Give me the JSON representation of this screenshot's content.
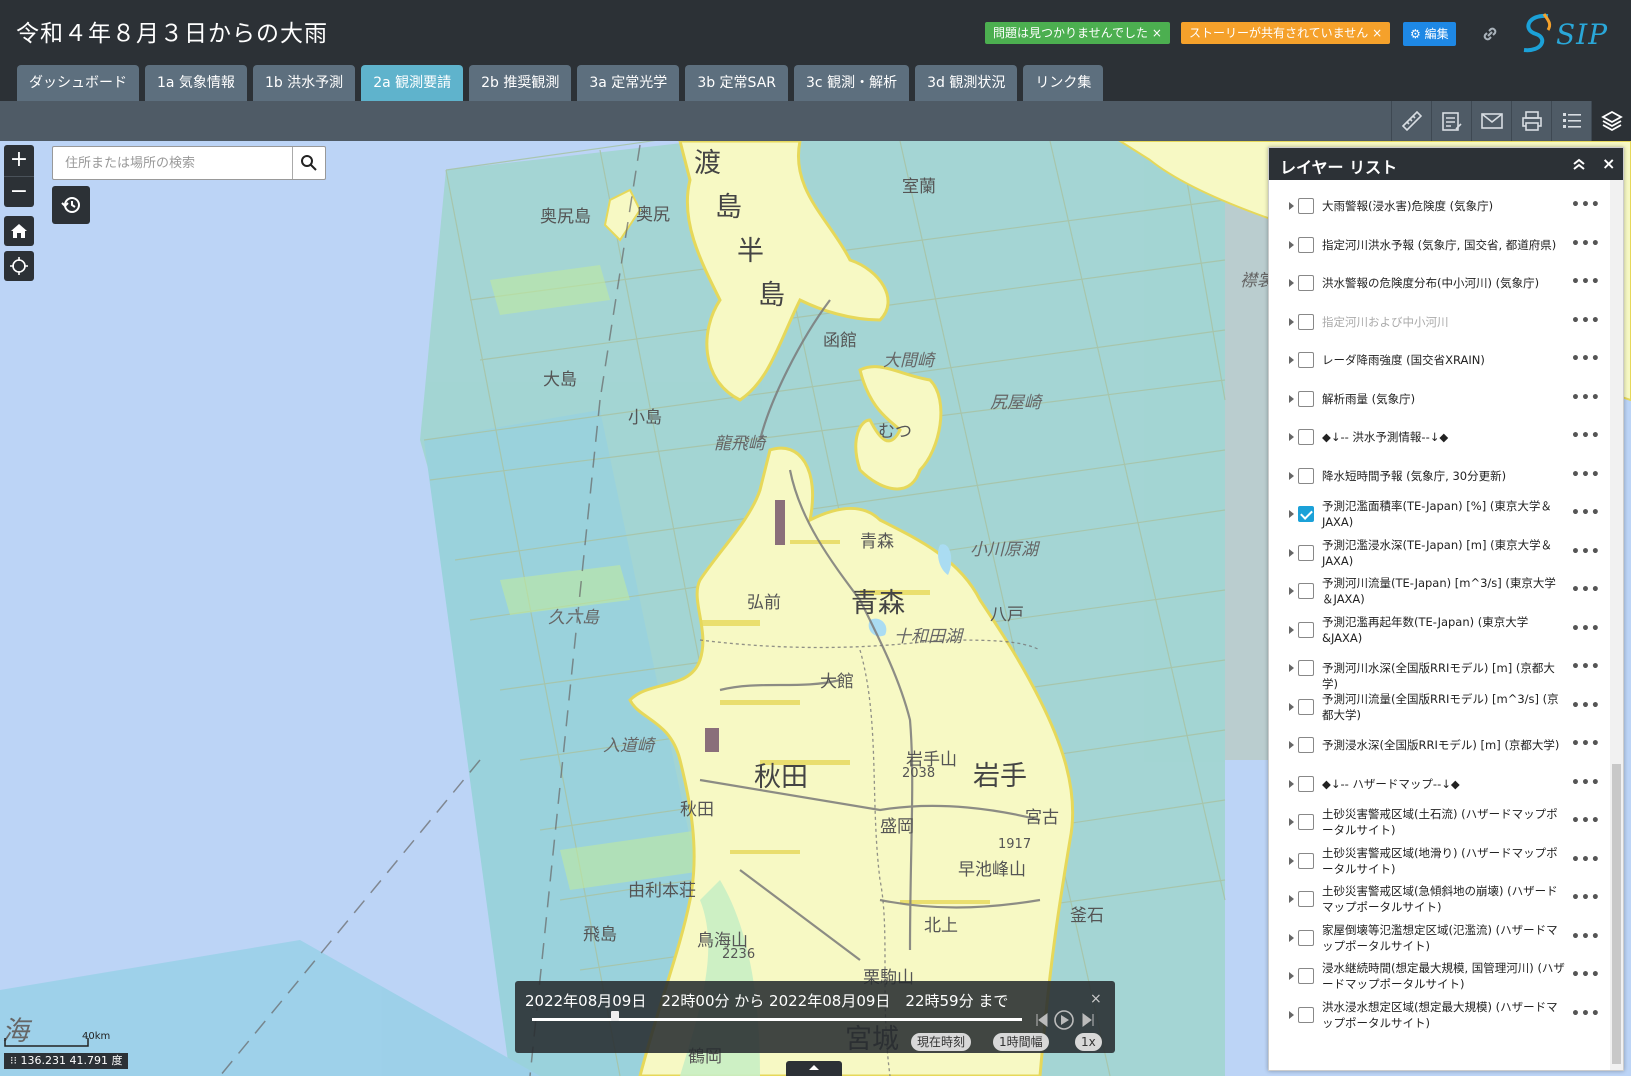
{
  "header": {
    "title": "令和４年８月３日からの大雨",
    "badge_problems": "問題は見つかりませんでした ×",
    "badge_story": "ストーリーが共有されていません ×",
    "edit_label": "編集",
    "logo_text": "SIP"
  },
  "tabs": [
    {
      "label": "ダッシュボード"
    },
    {
      "label": "1a 気象情報"
    },
    {
      "label": "1b 洪水予測"
    },
    {
      "label": "2a 観測要請"
    },
    {
      "label": "2b 推奨観測"
    },
    {
      "label": "3a 定常光学"
    },
    {
      "label": "3b 定常SAR"
    },
    {
      "label": "3c 観測・解析"
    },
    {
      "label": "3d 観測状況"
    },
    {
      "label": "リンク集"
    }
  ],
  "active_tab": "2a 観測要請",
  "search": {
    "placeholder": "住所または場所の検索"
  },
  "zoom": {
    "in_label": "+",
    "out_label": "−"
  },
  "layer_panel": {
    "title": "レイヤー リスト",
    "close_label": "×",
    "items": [
      {
        "label": "大雨警報(浸水害)危険度 (気象庁)",
        "checked": false
      },
      {
        "label": "指定河川洪水予報 (気象庁, 国交省, 都道府県)",
        "checked": false
      },
      {
        "label": "洪水警報の危険度分布(中小河川) (気象庁)",
        "checked": false
      },
      {
        "label": "指定河川および中小河川",
        "checked": false,
        "dim": true
      },
      {
        "label": "レーダ降雨強度 (国交省XRAIN)",
        "checked": false
      },
      {
        "label": "解析雨量 (気象庁)",
        "checked": false
      },
      {
        "label": "◆↓-- 洪水予測情報--↓◆",
        "checked": false
      },
      {
        "label": "降水短時間予報 (気象庁, 30分更新)",
        "checked": false
      },
      {
        "label": "予測氾濫面積率(TE-Japan) [%] (東京大学＆JAXA)",
        "checked": true
      },
      {
        "label": "予測氾濫浸水深(TE-Japan) [m] (東京大学＆JAXA)",
        "checked": false
      },
      {
        "label": "予測河川流量(TE-Japan) [m^3/s] (東京大学＆JAXA)",
        "checked": false
      },
      {
        "label": "予測氾濫再起年数(TE-Japan) (東京大学&JAXA)",
        "checked": false
      },
      {
        "label": "予測河川水深(全国版RRIモデル) [m] (京都大学)",
        "checked": false
      },
      {
        "label": "予測河川流量(全国版RRIモデル) [m^3/s] (京都大学)",
        "checked": false
      },
      {
        "label": "予測浸水深(全国版RRIモデル) [m] (京都大学)",
        "checked": false
      },
      {
        "label": "◆↓-- ハザードマップ--↓◆",
        "checked": false
      },
      {
        "label": "土砂災害警戒区域(土石流) (ハザードマップポータルサイト)",
        "checked": false
      },
      {
        "label": "土砂災害警戒区域(地滑り) (ハザードマップポータルサイト)",
        "checked": false
      },
      {
        "label": "土砂災害警戒区域(急傾斜地の崩壊) (ハザードマップポータルサイト)",
        "checked": false
      },
      {
        "label": "家屋倒壊等氾濫想定区域(氾濫流) (ハザードマップポータルサイト)",
        "checked": false
      },
      {
        "label": "浸水継続時間(想定最大規模, 国管理河川) (ハザードマップポータルサイト)",
        "checked": false
      },
      {
        "label": "洪水浸水想定区域(想定最大規模) (ハザードマップポータルサイト)",
        "checked": false
      }
    ]
  },
  "time_slider": {
    "text": "2022年08月09日　22時00分 から 2022年08月09日　22時59分 まで",
    "now_label": "現在時刻",
    "width_label": "1時間幅",
    "speed_label": "1x",
    "close_label": "×",
    "position": 0.17
  },
  "scale": {
    "label": "40km"
  },
  "coords": {
    "text": "136.231 41.791 度"
  },
  "map_labels": {
    "oshima_a": "渡",
    "oshima_b": "島",
    "oshima_c": "半",
    "oshima_d": "島",
    "okushiri_island": "奥尻島",
    "okushiri": "奥尻",
    "muroran": "室蘭",
    "hakodate": "函館",
    "oomazaki": "大間崎",
    "shiriyazaki": "尻屋崎",
    "oshima_island": "大島",
    "kojima": "小島",
    "tappizaki": "龍飛崎",
    "mutsu": "むつ",
    "aomori_city": "青森",
    "ogawara": "小川原湖",
    "kurosaki": "久六島",
    "hirosaki": "弘前",
    "aomori_pref": "青森",
    "towada": "十和田湖",
    "hachinohe": "八戸",
    "odate": "大館",
    "nyudozaki": "入道崎",
    "akita_pref": "秋田",
    "iwate_pref": "岩手",
    "iwatesan": "岩手山",
    "iwatesan_h": "2038",
    "akita_city": "秋田",
    "morioka": "盛岡",
    "miyako": "宮古",
    "hayachine_h": "1917",
    "hayachine": "早池峰山",
    "yurihonjo": "由利本荘",
    "kitakami": "北上",
    "kamaishi": "釜石",
    "tobishima": "飛島",
    "chokai": "鳥海山",
    "chokai_h": "2236",
    "kurikoma": "栗駒山",
    "miyagi": "宮城",
    "tsuruoka": "鶴岡",
    "erimo": "襟裳",
    "sea": "海"
  },
  "colors": {
    "header": "#2c3136",
    "tab": "#5d6f7e",
    "tab_active": "#5fb3cc",
    "badge_green": "#4caf50",
    "badge_orange": "#f5a12b",
    "edit_blue": "#1e88e5",
    "sea": "#bcd4f6",
    "land": "#f7f9c4"
  }
}
